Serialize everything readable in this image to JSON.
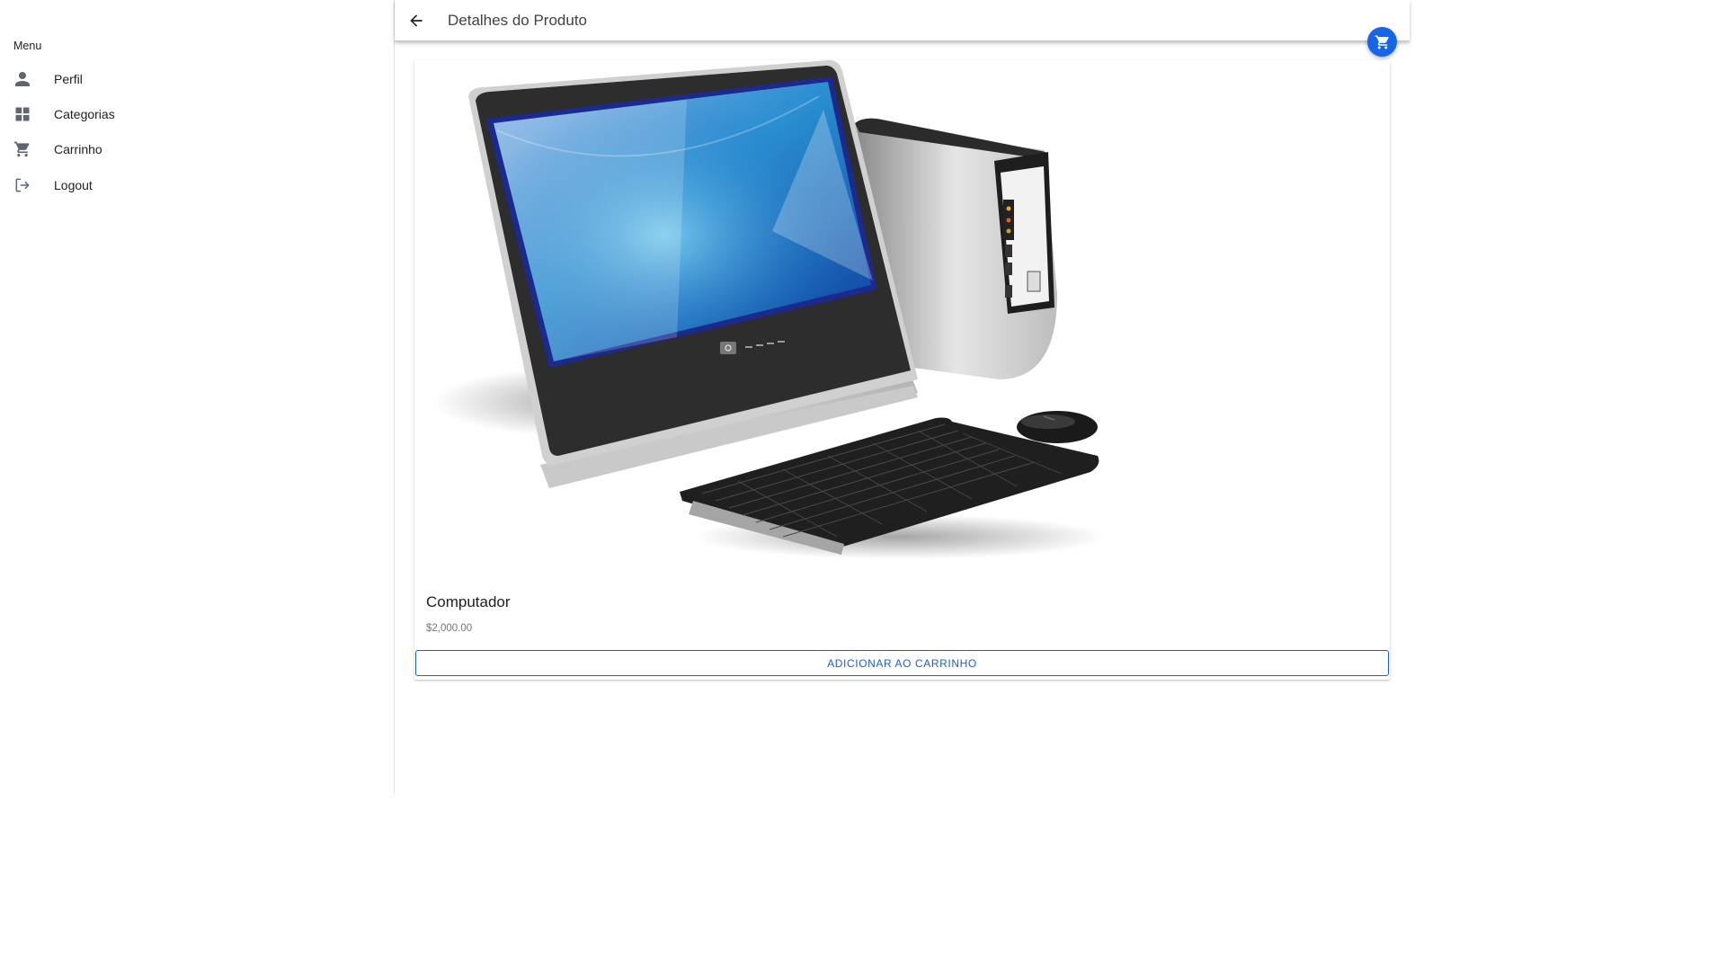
{
  "sidebar": {
    "title": "Menu",
    "items": [
      {
        "label": "Perfil",
        "icon": "person-icon"
      },
      {
        "label": "Categorias",
        "icon": "grid-icon"
      },
      {
        "label": "Carrinho",
        "icon": "cart-icon"
      },
      {
        "label": "Logout",
        "icon": "logout-icon"
      }
    ]
  },
  "header": {
    "title": "Detalhes do Produto",
    "back_icon": "arrow-back-icon"
  },
  "fab": {
    "icon": "cart-icon"
  },
  "product": {
    "name": "Computador",
    "price": "$2,000.00",
    "image": "desktop-computer-image",
    "add_button_label": "ADICIONAR AO CARRINHO"
  },
  "colors": {
    "accent": "#1565e6",
    "icon_gray": "#5f6672"
  }
}
